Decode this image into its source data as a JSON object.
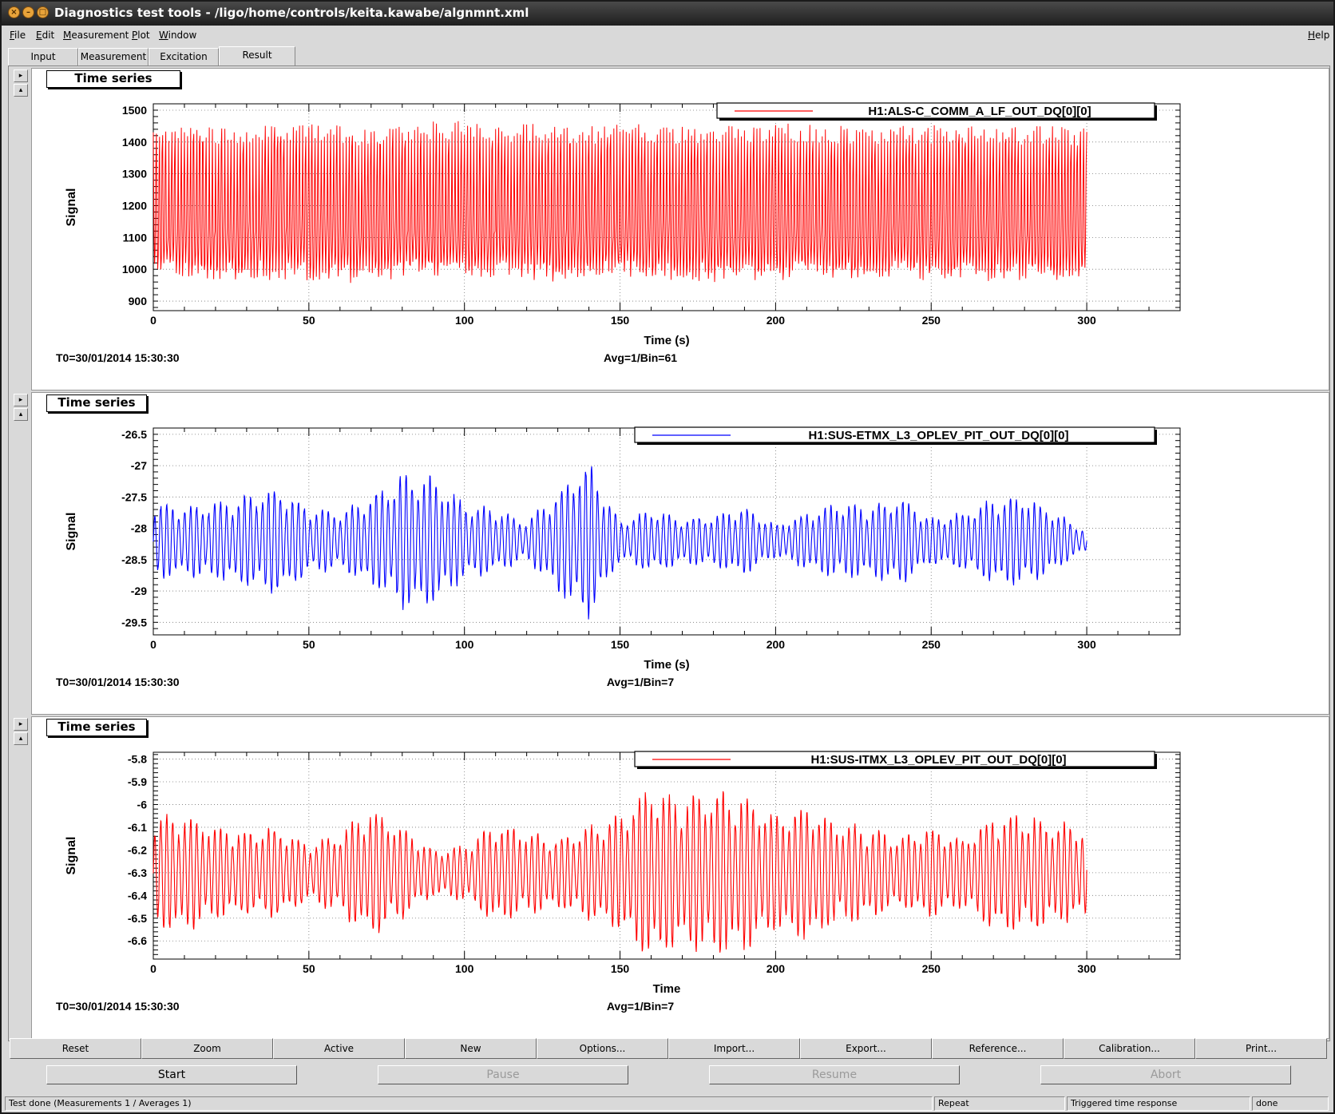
{
  "window": {
    "title": "Diagnostics test tools - /ligo/home/controls/keita.kawabe/algnmnt.xml",
    "buttons": [
      "close",
      "minimize",
      "maximize"
    ]
  },
  "menubar": {
    "items": [
      "File",
      "Edit",
      "Measurement",
      "Plot",
      "Window"
    ],
    "help": "Help"
  },
  "tabs": [
    {
      "label": "Input",
      "active": false
    },
    {
      "label": "Measurement",
      "active": false
    },
    {
      "label": "Excitation",
      "active": false
    },
    {
      "label": "Result",
      "active": true
    }
  ],
  "plots": [
    {
      "pad_title": "Time series",
      "legend": "H1:ALS-C_COMM_A_LF_OUT_DQ[0][0]",
      "color": "#ff0000",
      "ylabel": "Signal",
      "xlabel": "Time (s)",
      "t0": "T0=30/01/2014 15:30:30",
      "avg": "Avg=1/Bin=61"
    },
    {
      "pad_title": "Time series",
      "legend": "H1:SUS-ETMX_L3_OPLEV_PIT_OUT_DQ[0][0]",
      "color": "#0000ff",
      "ylabel": "Signal",
      "xlabel": "Time (s)",
      "t0": "T0=30/01/2014 15:30:30",
      "avg": "Avg=1/Bin=7"
    },
    {
      "pad_title": "Time series",
      "legend": "H1:SUS-ITMX_L3_OPLEV_PIT_OUT_DQ[0][0]",
      "color": "#ff0000",
      "ylabel": "Signal",
      "xlabel": "Time",
      "t0": "T0=30/01/2014 15:30:30",
      "avg": "Avg=1/Bin=7"
    }
  ],
  "chart_data": [
    {
      "type": "line",
      "title": "Time series",
      "xlabel": "Time (s)",
      "ylabel": "Signal",
      "xlim": [
        0,
        330
      ],
      "ylim": [
        870,
        1520
      ],
      "xticks": [
        "0",
        "50",
        "100",
        "150",
        "200",
        "250",
        "300"
      ],
      "yticks": [
        "900",
        "1000",
        "1100",
        "1200",
        "1300",
        "1400",
        "1500"
      ],
      "grid": true,
      "legend_position": "top-right",
      "series": [
        {
          "name": "H1:ALS-C_COMM_A_LF_OUT_DQ[0][0]",
          "color": "#ff0000",
          "x": [
            0,
            10,
            20,
            30,
            40,
            50,
            60,
            70,
            80,
            90,
            100,
            110,
            120,
            130,
            140,
            150,
            160,
            170,
            180,
            190,
            200,
            210,
            220,
            230,
            240,
            250,
            260,
            270,
            280,
            290,
            300
          ],
          "upper": [
            1445,
            1455,
            1450,
            1455,
            1458,
            1465,
            1455,
            1440,
            1462,
            1465,
            1468,
            1460,
            1458,
            1455,
            1452,
            1458,
            1455,
            1455,
            1455,
            1450,
            1460,
            1455,
            1455,
            1452,
            1450,
            1455,
            1450,
            1450,
            1450,
            1450,
            1445
          ],
          "lower": [
            990,
            975,
            960,
            970,
            965,
            965,
            955,
            960,
            970,
            975,
            965,
            975,
            965,
            960,
            965,
            975,
            960,
            965,
            960,
            955,
            965,
            965,
            960,
            965,
            970,
            960,
            965,
            960,
            965,
            965,
            965
          ],
          "mid_band": [
            1100,
            1120
          ]
        }
      ]
    },
    {
      "type": "line",
      "title": "Time series",
      "xlabel": "Time (s)",
      "ylabel": "Signal",
      "xlim": [
        0,
        330
      ],
      "ylim": [
        -29.7,
        -26.4
      ],
      "xticks": [
        "0",
        "50",
        "100",
        "150",
        "200",
        "250",
        "300"
      ],
      "yticks": [
        "-26.5",
        "-27",
        "-27.5",
        "-28",
        "-28.5",
        "-29",
        "-29.5"
      ],
      "grid": true,
      "legend_position": "top-right",
      "series": [
        {
          "name": "H1:SUS-ETMX_L3_OPLEV_PIT_OUT_DQ[0][0]",
          "color": "#0000ff",
          "center": -28.2,
          "x": [
            0,
            10,
            20,
            30,
            40,
            50,
            60,
            70,
            80,
            90,
            100,
            110,
            120,
            130,
            140,
            150,
            160,
            170,
            180,
            190,
            200,
            210,
            220,
            230,
            240,
            250,
            260,
            270,
            280,
            290,
            300
          ],
          "amplitude": [
            0.6,
            0.55,
            0.6,
            0.7,
            0.85,
            0.5,
            0.45,
            0.7,
            1.05,
            1.0,
            0.6,
            0.5,
            0.3,
            0.8,
            1.25,
            0.3,
            0.5,
            0.35,
            0.4,
            0.55,
            0.25,
            0.45,
            0.6,
            0.55,
            0.7,
            0.35,
            0.45,
            0.65,
            0.7,
            0.45,
            0.15
          ]
        }
      ]
    },
    {
      "type": "line",
      "title": "Time series",
      "xlabel": "Time",
      "ylabel": "Signal",
      "xlim": [
        0,
        330
      ],
      "ylim": [
        -6.68,
        -5.77
      ],
      "xticks": [
        "0",
        "50",
        "100",
        "150",
        "200",
        "250",
        "300"
      ],
      "yticks": [
        "-5.8",
        "-5.9",
        "-6",
        "-6.1",
        "-6.2",
        "-6.3",
        "-6.4",
        "-6.5",
        "-6.6"
      ],
      "grid": true,
      "legend_position": "top-right",
      "series": [
        {
          "name": "H1:SUS-ITMX_L3_OPLEV_PIT_OUT_DQ[0][0]",
          "color": "#ff0000",
          "center": -6.3,
          "x": [
            0,
            10,
            20,
            30,
            40,
            50,
            60,
            70,
            80,
            90,
            100,
            110,
            120,
            130,
            140,
            150,
            160,
            170,
            180,
            190,
            200,
            210,
            220,
            230,
            240,
            250,
            260,
            270,
            280,
            290,
            300
          ],
          "amplitude": [
            0.25,
            0.25,
            0.2,
            0.18,
            0.2,
            0.12,
            0.18,
            0.28,
            0.2,
            0.1,
            0.12,
            0.22,
            0.18,
            0.15,
            0.2,
            0.25,
            0.38,
            0.32,
            0.35,
            0.33,
            0.25,
            0.3,
            0.22,
            0.2,
            0.15,
            0.2,
            0.15,
            0.25,
            0.25,
            0.22,
            0.2
          ]
        }
      ]
    }
  ],
  "toolbar": [
    "Reset",
    "Zoom",
    "Active",
    "New",
    "Options...",
    "Import...",
    "Export...",
    "Reference...",
    "Calibration...",
    "Print..."
  ],
  "controls": [
    {
      "label": "Start",
      "enabled": true
    },
    {
      "label": "Pause",
      "enabled": false
    },
    {
      "label": "Resume",
      "enabled": false
    },
    {
      "label": "Abort",
      "enabled": false
    }
  ],
  "status": {
    "message": "Test done (Measurements 1 / Averages 1)",
    "repeat": "Repeat",
    "mode": "Triggered time response",
    "state": "done"
  }
}
